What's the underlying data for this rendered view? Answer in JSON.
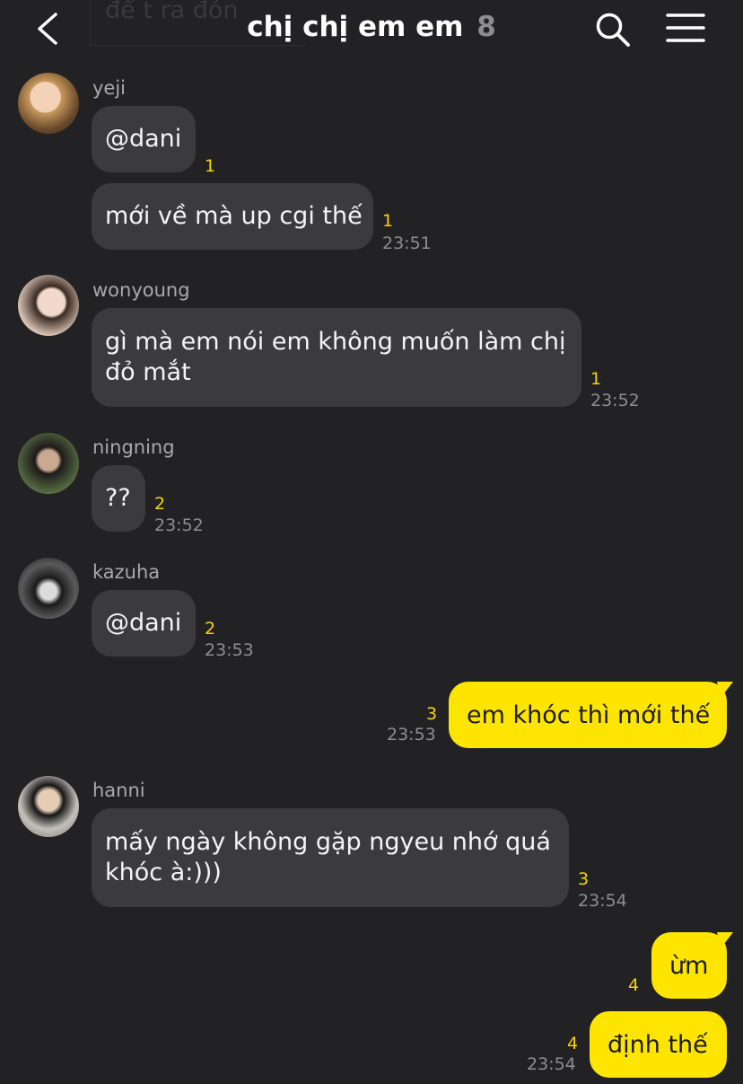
{
  "header": {
    "title": "chị chị em em",
    "member_count": "8",
    "draft_preview": "để t ra đón",
    "back_icon": "chevron-left-icon",
    "search_icon": "search-icon",
    "menu_icon": "menu-icon"
  },
  "colors": {
    "background": "#222224",
    "bubble_other": "#3b3b3e",
    "bubble_mine": "#fee500",
    "unread": "#f5d20a",
    "time": "#8e8e91"
  },
  "messages": [
    {
      "sender": "yeji",
      "text": "@dani",
      "unread": "1"
    },
    {
      "text": "mới về mà up cgi thế",
      "unread": "1",
      "time": "23:51"
    },
    {
      "sender": "wonyoung",
      "lines": [
        "gì mà em nói em không muốn làm chị",
        "đỏ mắt"
      ],
      "unread": "1",
      "time": "23:52"
    },
    {
      "sender": "ningning",
      "text": "??",
      "unread": "2",
      "time": "23:52"
    },
    {
      "sender": "kazuha",
      "text": "@dani",
      "unread": "2",
      "time": "23:53"
    },
    {
      "mine": true,
      "text": "em khóc thì mới thế",
      "unread": "3",
      "time": "23:53"
    },
    {
      "sender": "hanni",
      "lines": [
        "mấy ngày không gặp ngyeu nhớ quá",
        "khóc à:)))"
      ],
      "unread": "3",
      "time": "23:54"
    },
    {
      "mine": true,
      "text": "ừm",
      "unread": "4"
    },
    {
      "mine": true,
      "text": "định thế",
      "unread": "4",
      "time": "23:54"
    }
  ]
}
